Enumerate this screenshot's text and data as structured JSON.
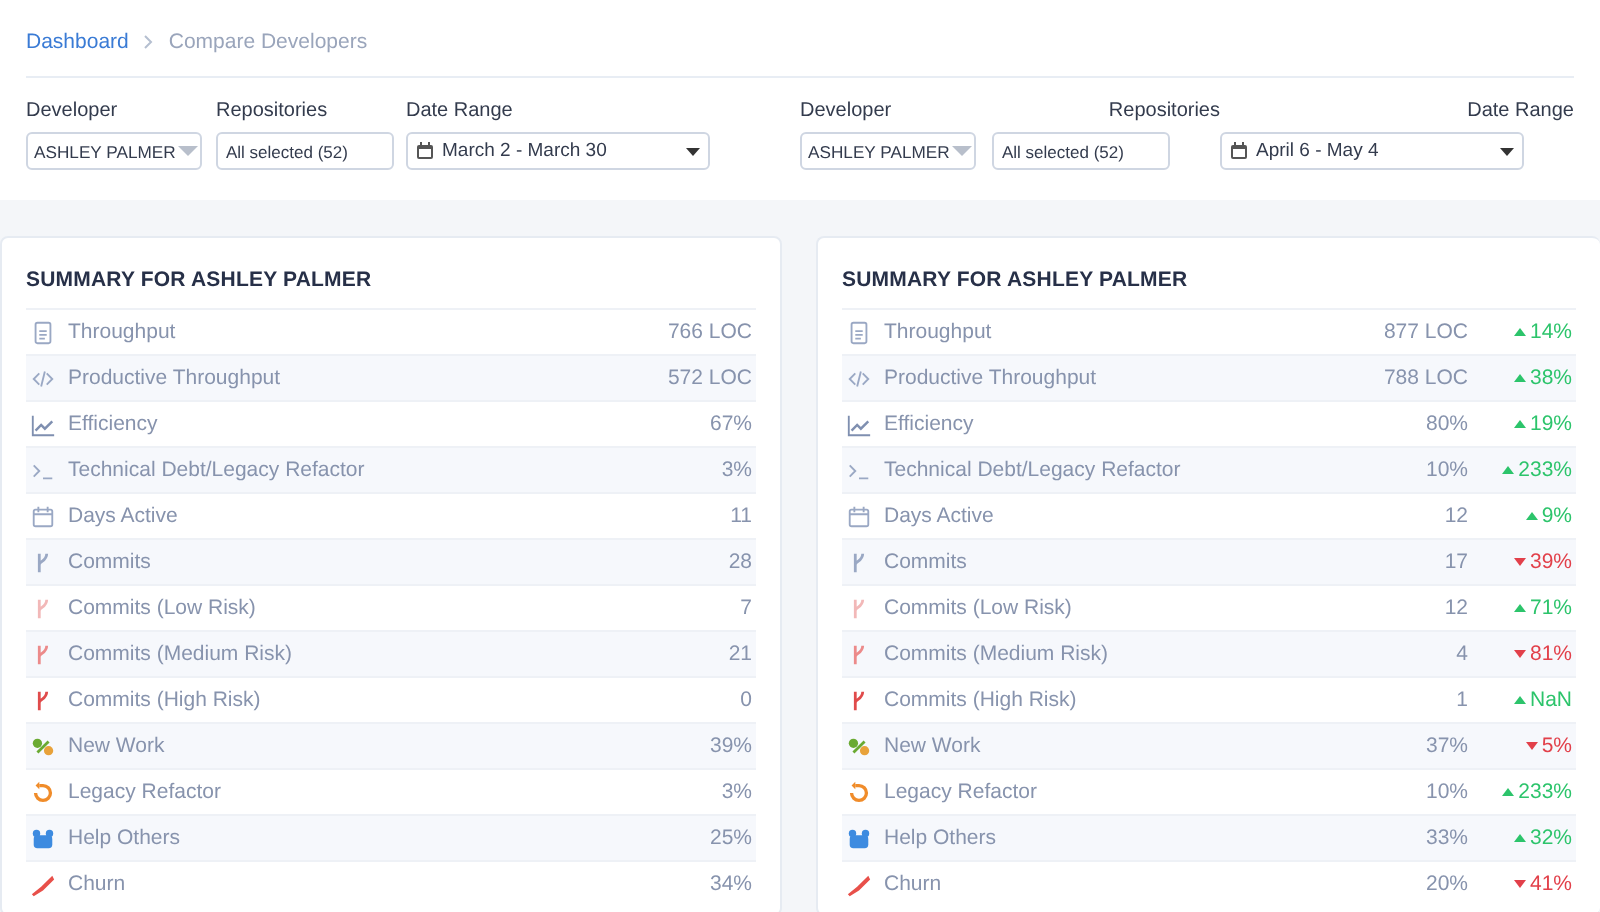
{
  "breadcrumb": [
    {
      "label": "Dashboard",
      "kind": "link"
    },
    {
      "label": "Compare Developers",
      "kind": "current"
    }
  ],
  "panels": [
    {
      "filters": {
        "developer_label": "Developer",
        "developer": "ASHLEY PALMER",
        "repositories_label": "Repositories",
        "repositories": "All selected (52)",
        "date_label": "Date Range",
        "date": "March 2 - March 30"
      },
      "summary": {
        "title": "SUMMARY FOR ASHLEY PALMER",
        "metrics": [
          {
            "kind": "document",
            "label": "Throughput",
            "value": "766 LOC"
          },
          {
            "kind": "code",
            "label": "Productive Throughput",
            "value": "572 LOC"
          },
          {
            "kind": "chart",
            "label": "Efficiency",
            "value": "67%"
          },
          {
            "kind": "terminal",
            "label": "Technical Debt/Legacy Refactor",
            "value": "3%"
          },
          {
            "kind": "calendar",
            "label": "Days Active",
            "value": "11"
          },
          {
            "kind": "commit",
            "label": "Commits",
            "value": "28"
          },
          {
            "kind": "commit-low",
            "label": "Commits (Low Risk)",
            "value": "7"
          },
          {
            "kind": "commit-medium",
            "label": "Commits (Medium Risk)",
            "value": "21"
          },
          {
            "kind": "commit-high",
            "label": "Commits (High Risk)",
            "value": "0"
          },
          {
            "kind": "new-work",
            "label": "New Work",
            "value": "39%"
          },
          {
            "kind": "refactor",
            "label": "Legacy Refactor",
            "value": "3%"
          },
          {
            "kind": "help",
            "label": "Help Others",
            "value": "25%"
          },
          {
            "kind": "churn",
            "label": "Churn",
            "value": "34%"
          }
        ]
      }
    },
    {
      "filters": {
        "developer_label": "Developer",
        "developer": "ASHLEY PALMER",
        "repositories_label": "Repositories",
        "repositories": "All selected (52)",
        "date_label": "Date Range",
        "date": "April 6 - May 4"
      },
      "summary": {
        "title": "SUMMARY FOR ASHLEY PALMER",
        "metrics": [
          {
            "kind": "document",
            "label": "Throughput",
            "value": "877 LOC",
            "change": {
              "increase": true,
              "text": "14%"
            }
          },
          {
            "kind": "code",
            "label": "Productive Throughput",
            "value": "788 LOC",
            "change": {
              "increase": true,
              "text": "38%"
            }
          },
          {
            "kind": "chart",
            "label": "Efficiency",
            "value": "80%",
            "change": {
              "increase": true,
              "text": "19%"
            }
          },
          {
            "kind": "terminal",
            "label": "Technical Debt/Legacy Refactor",
            "value": "10%",
            "change": {
              "increase": true,
              "text": "233%"
            }
          },
          {
            "kind": "calendar",
            "label": "Days Active",
            "value": "12",
            "change": {
              "increase": true,
              "text": "9%"
            }
          },
          {
            "kind": "commit",
            "label": "Commits",
            "value": "17",
            "change": {
              "increase": false,
              "text": "39%"
            }
          },
          {
            "kind": "commit-low",
            "label": "Commits (Low Risk)",
            "value": "12",
            "change": {
              "increase": true,
              "text": "71%"
            }
          },
          {
            "kind": "commit-medium",
            "label": "Commits (Medium Risk)",
            "value": "4",
            "change": {
              "increase": false,
              "text": "81%"
            }
          },
          {
            "kind": "commit-high",
            "label": "Commits (High Risk)",
            "value": "1",
            "change": {
              "increase": true,
              "text": "NaN"
            }
          },
          {
            "kind": "new-work",
            "label": "New Work",
            "value": "37%",
            "change": {
              "increase": false,
              "text": "5%"
            }
          },
          {
            "kind": "refactor",
            "label": "Legacy Refactor",
            "value": "10%",
            "change": {
              "increase": true,
              "text": "233%"
            }
          },
          {
            "kind": "help",
            "label": "Help Others",
            "value": "33%",
            "change": {
              "increase": true,
              "text": "32%"
            }
          },
          {
            "kind": "churn",
            "label": "Churn",
            "value": "20%",
            "change": {
              "increase": false,
              "text": "41%"
            }
          }
        ]
      }
    }
  ]
}
